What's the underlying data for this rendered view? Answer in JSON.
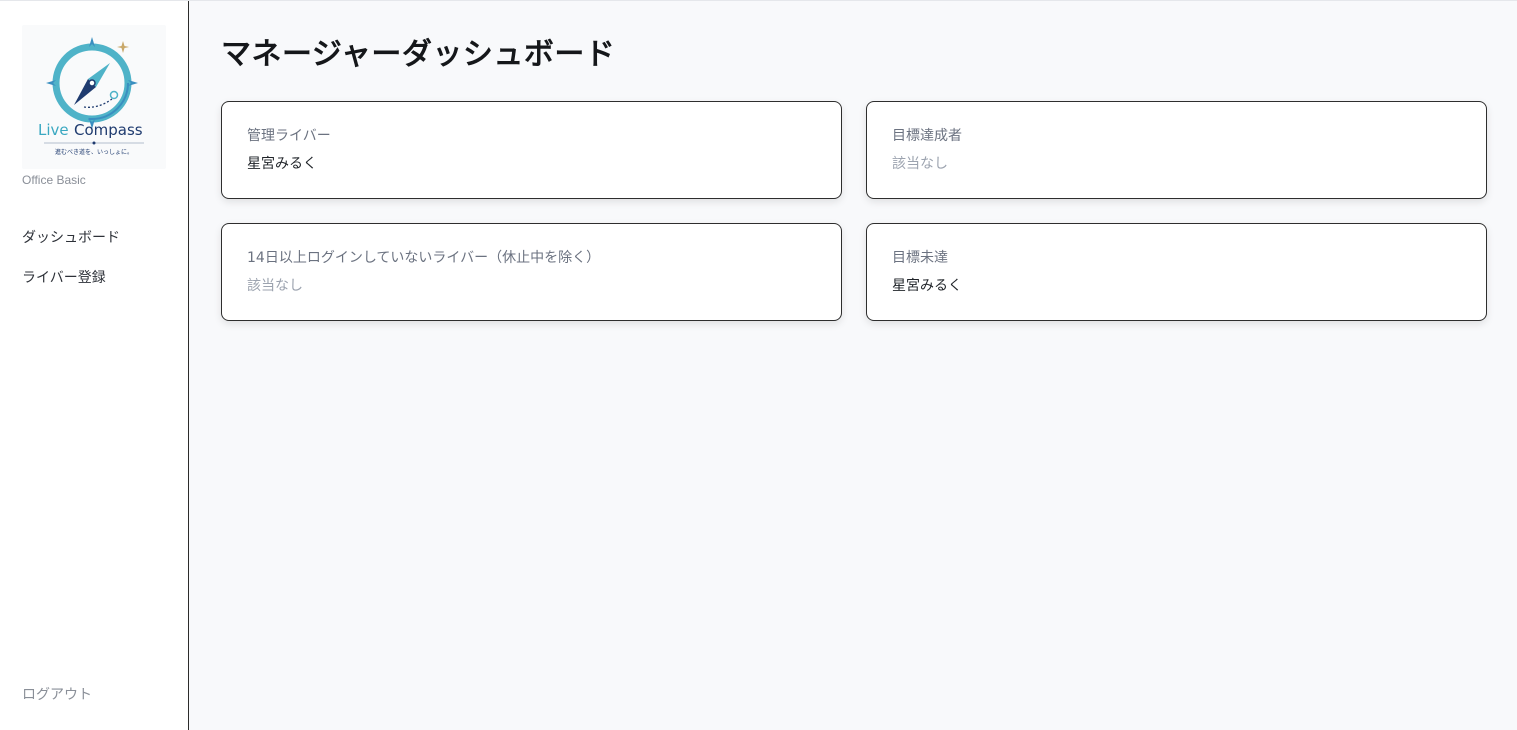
{
  "sidebar": {
    "logo": {
      "brand": "LiveCompass",
      "tagline": "進むべき道を、いっしょに。",
      "colors": {
        "teal": "#4fb3c8",
        "navy": "#1f3b6f",
        "gold": "#c9a86a"
      }
    },
    "plan": "Office Basic",
    "nav": [
      {
        "label": "ダッシュボード"
      },
      {
        "label": "ライバー登録"
      }
    ],
    "logout": "ログアウト"
  },
  "main": {
    "title": "マネージャーダッシュボード",
    "cards": [
      {
        "label": "管理ライバー",
        "value": "星宮みるく",
        "empty": false
      },
      {
        "label": "目標達成者",
        "value": "該当なし",
        "empty": true
      },
      {
        "label": "14日以上ログインしていないライバー（休止中を除く）",
        "value": "該当なし",
        "empty": true
      },
      {
        "label": "目標未達",
        "value": "星宮みるく",
        "empty": false
      }
    ]
  }
}
